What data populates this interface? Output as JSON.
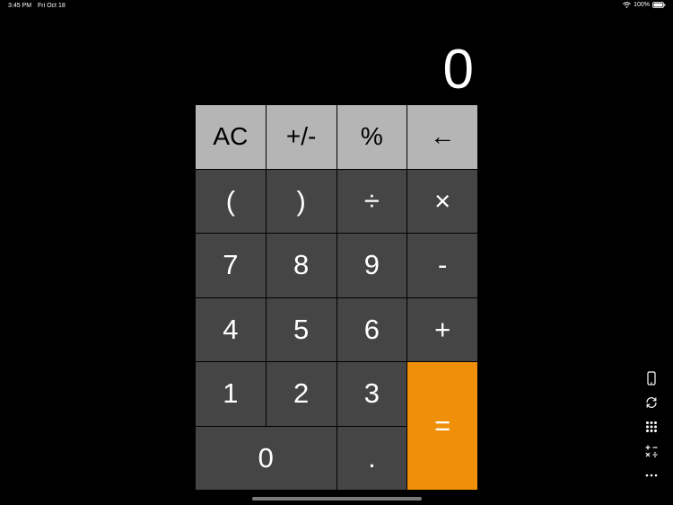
{
  "status_bar": {
    "time": "3:45 PM",
    "date": "Fri Oct 18",
    "battery": "100%"
  },
  "display": {
    "value": "0"
  },
  "keys": {
    "ac": "AC",
    "sign": "+/-",
    "percent": "%",
    "backspace": "←",
    "open_paren": "(",
    "close_paren": ")",
    "divide": "÷",
    "multiply": "×",
    "seven": "7",
    "eight": "8",
    "nine": "9",
    "minus": "-",
    "four": "4",
    "five": "5",
    "six": "6",
    "plus": "+",
    "one": "1",
    "two": "2",
    "three": "3",
    "equals": "=",
    "zero": "0",
    "decimal": "."
  },
  "colors": {
    "function_key": "#b5b5b5",
    "number_key": "#454545",
    "equals_key": "#f0900a",
    "background": "#000000"
  },
  "side_toolbar": {
    "icons": [
      "phone-icon",
      "rotate-icon",
      "keypad-grid-icon",
      "operators-icon",
      "more-icon"
    ]
  }
}
